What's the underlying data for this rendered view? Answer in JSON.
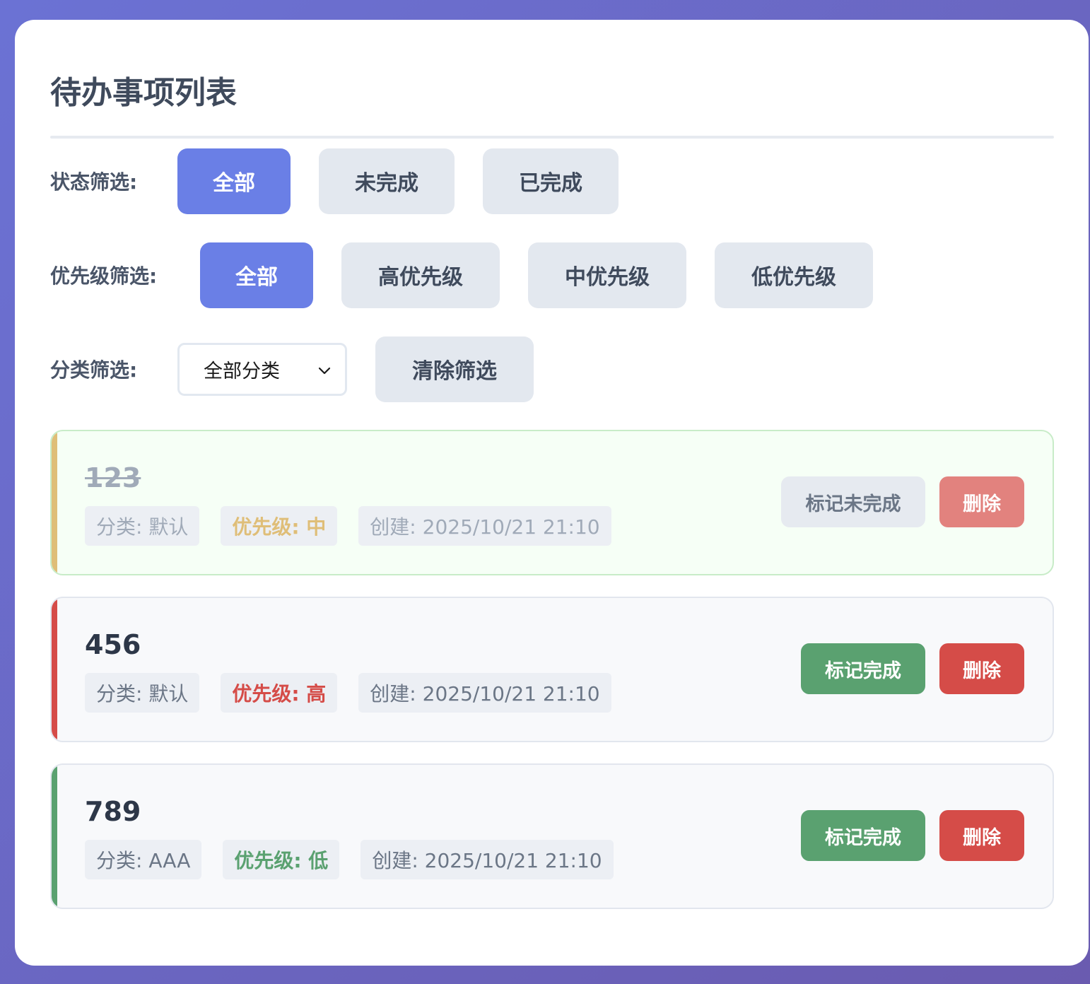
{
  "title": "待办事项列表",
  "filters": {
    "status": {
      "label": "状态筛选:",
      "options": [
        "全部",
        "未完成",
        "已完成"
      ],
      "active": 0
    },
    "priority": {
      "label": "优先级筛选:",
      "options": [
        "全部",
        "高优先级",
        "中优先级",
        "低优先级"
      ],
      "active": 0
    },
    "category": {
      "label": "分类筛选:",
      "selected": "全部分类",
      "clear_label": "清除筛选"
    }
  },
  "todos": [
    {
      "name": "123",
      "completed": true,
      "category": "分类: 默认",
      "priority_label": "优先级: 中",
      "priority": "medium",
      "created": "创建: 2025/10/21 21:10",
      "toggle_label": "标记未完成",
      "delete_label": "删除"
    },
    {
      "name": "456",
      "completed": false,
      "category": "分类: 默认",
      "priority_label": "优先级: 高",
      "priority": "high",
      "created": "创建: 2025/10/21 21:10",
      "toggle_label": "标记完成",
      "delete_label": "删除"
    },
    {
      "name": "789",
      "completed": false,
      "category": "分类: AAA",
      "priority_label": "优先级: 低",
      "priority": "low",
      "created": "创建: 2025/10/21 21:10",
      "toggle_label": "标记完成",
      "delete_label": "删除"
    }
  ],
  "colors": {
    "accent": "#6a7fe6",
    "high": "#d54c48",
    "medium": "#dfbe78",
    "low": "#5aa170",
    "complete_button": "#5aa170",
    "delete_button": "#d54c48"
  },
  "icons": {
    "select_arrow": "chevron-down-icon"
  }
}
